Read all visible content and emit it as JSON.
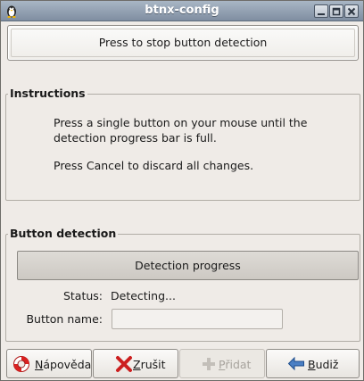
{
  "window": {
    "title": "btnx-config"
  },
  "top_button": {
    "label": "Press to stop button detection"
  },
  "instructions": {
    "heading": "Instructions",
    "line1": "Press a single button on your mouse until the",
    "line2": "detection progress bar is full.",
    "line3": "Press Cancel to discard all changes."
  },
  "detection": {
    "heading": "Button detection",
    "progress_label": "Detection progress",
    "status_label": "Status:",
    "status_value": "Detecting...",
    "name_label": "Button name:",
    "name_value": ""
  },
  "buttons": {
    "help": {
      "first": "N",
      "rest": "ápověda"
    },
    "cancel": {
      "first": "Z",
      "rest": "rušit"
    },
    "add": {
      "first": "P",
      "rest": "řidat"
    },
    "forward": {
      "first": "B",
      "rest": "udiž"
    }
  },
  "colors": {
    "titlebar": "#8f9db0",
    "window_bg": "#efebe7",
    "cancel_icon": "#cc1f1f",
    "forward_icon": "#3c6fb6"
  }
}
